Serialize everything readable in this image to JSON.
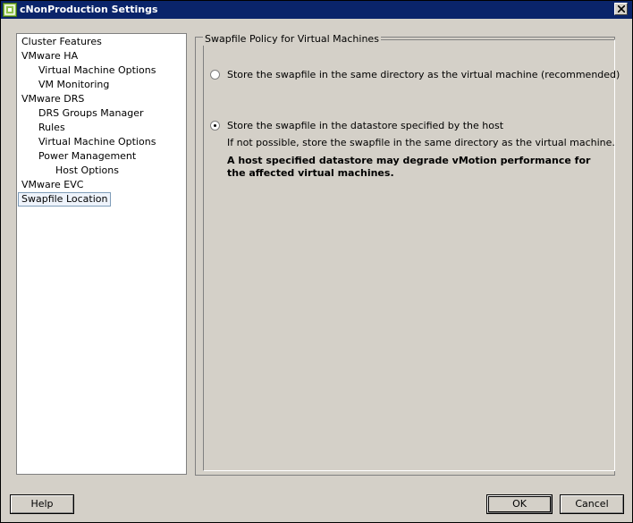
{
  "window": {
    "title": "cNonProduction Settings"
  },
  "tree": {
    "items": [
      {
        "label": "Cluster Features",
        "level": 0,
        "selected": false
      },
      {
        "label": "VMware HA",
        "level": 0,
        "selected": false
      },
      {
        "label": "Virtual Machine Options",
        "level": 1,
        "selected": false
      },
      {
        "label": "VM Monitoring",
        "level": 1,
        "selected": false
      },
      {
        "label": "VMware DRS",
        "level": 0,
        "selected": false
      },
      {
        "label": "DRS Groups Manager",
        "level": 1,
        "selected": false
      },
      {
        "label": "Rules",
        "level": 1,
        "selected": false
      },
      {
        "label": "Virtual Machine Options",
        "level": 1,
        "selected": false
      },
      {
        "label": "Power Management",
        "level": 1,
        "selected": false
      },
      {
        "label": "Host Options",
        "level": 2,
        "selected": false
      },
      {
        "label": "VMware EVC",
        "level": 0,
        "selected": false
      },
      {
        "label": "Swapfile Location",
        "level": 0,
        "selected": true
      }
    ]
  },
  "swapfile": {
    "group_title": "Swapfile Policy for Virtual Machines",
    "option1_label": "Store the swapfile in the same directory as the virtual machine (recommended)",
    "option1_checked": false,
    "option2_label": "Store the swapfile in the datastore specified by the host",
    "option2_checked": true,
    "option2_note": "If not possible, store the swapfile in the same directory as the virtual machine.",
    "warning": "A host specified datastore may degrade vMotion performance for the affected virtual machines."
  },
  "buttons": {
    "help": "Help",
    "ok": "OK",
    "cancel": "Cancel"
  }
}
